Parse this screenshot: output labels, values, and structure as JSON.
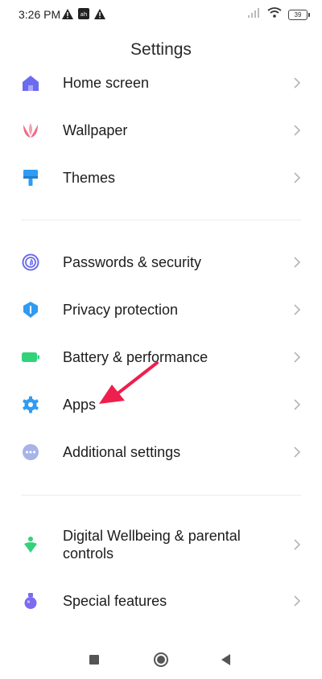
{
  "status_bar": {
    "time": "3:26 PM",
    "left_icons": [
      "warning-icon",
      "app-icon",
      "warning-icon"
    ],
    "battery": "39"
  },
  "header": {
    "title": "Settings"
  },
  "groups": [
    [
      {
        "label": "Home screen",
        "icon": "home-icon",
        "color": "#6b6bf0"
      },
      {
        "label": "Wallpaper",
        "icon": "tulip-icon",
        "color": "#ef6b86"
      },
      {
        "label": "Themes",
        "icon": "brush-icon",
        "color": "#2f9bf2"
      }
    ],
    [
      {
        "label": "Passwords & security",
        "icon": "fingerprint-icon",
        "color": "#6b6bf0"
      },
      {
        "label": "Privacy protection",
        "icon": "shield-icon",
        "color": "#2f9bf2"
      },
      {
        "label": "Battery & performance",
        "icon": "battery-icon",
        "color": "#34d17b"
      },
      {
        "label": "Apps",
        "icon": "gear-icon",
        "color": "#2f9bf2"
      },
      {
        "label": "Additional settings",
        "icon": "more-dots-icon",
        "color": "#a8b3e8"
      }
    ],
    [
      {
        "label": "Digital Wellbeing & parental controls",
        "icon": "wellbeing-icon",
        "color": "#34d17b"
      },
      {
        "label": "Special features",
        "icon": "potion-icon",
        "color": "#7b6bf0"
      }
    ]
  ],
  "annotation": {
    "arrow_color": "#ee1f4d",
    "points_to": "Apps"
  },
  "nav_bar": [
    "recents-button",
    "home-button",
    "back-button"
  ]
}
